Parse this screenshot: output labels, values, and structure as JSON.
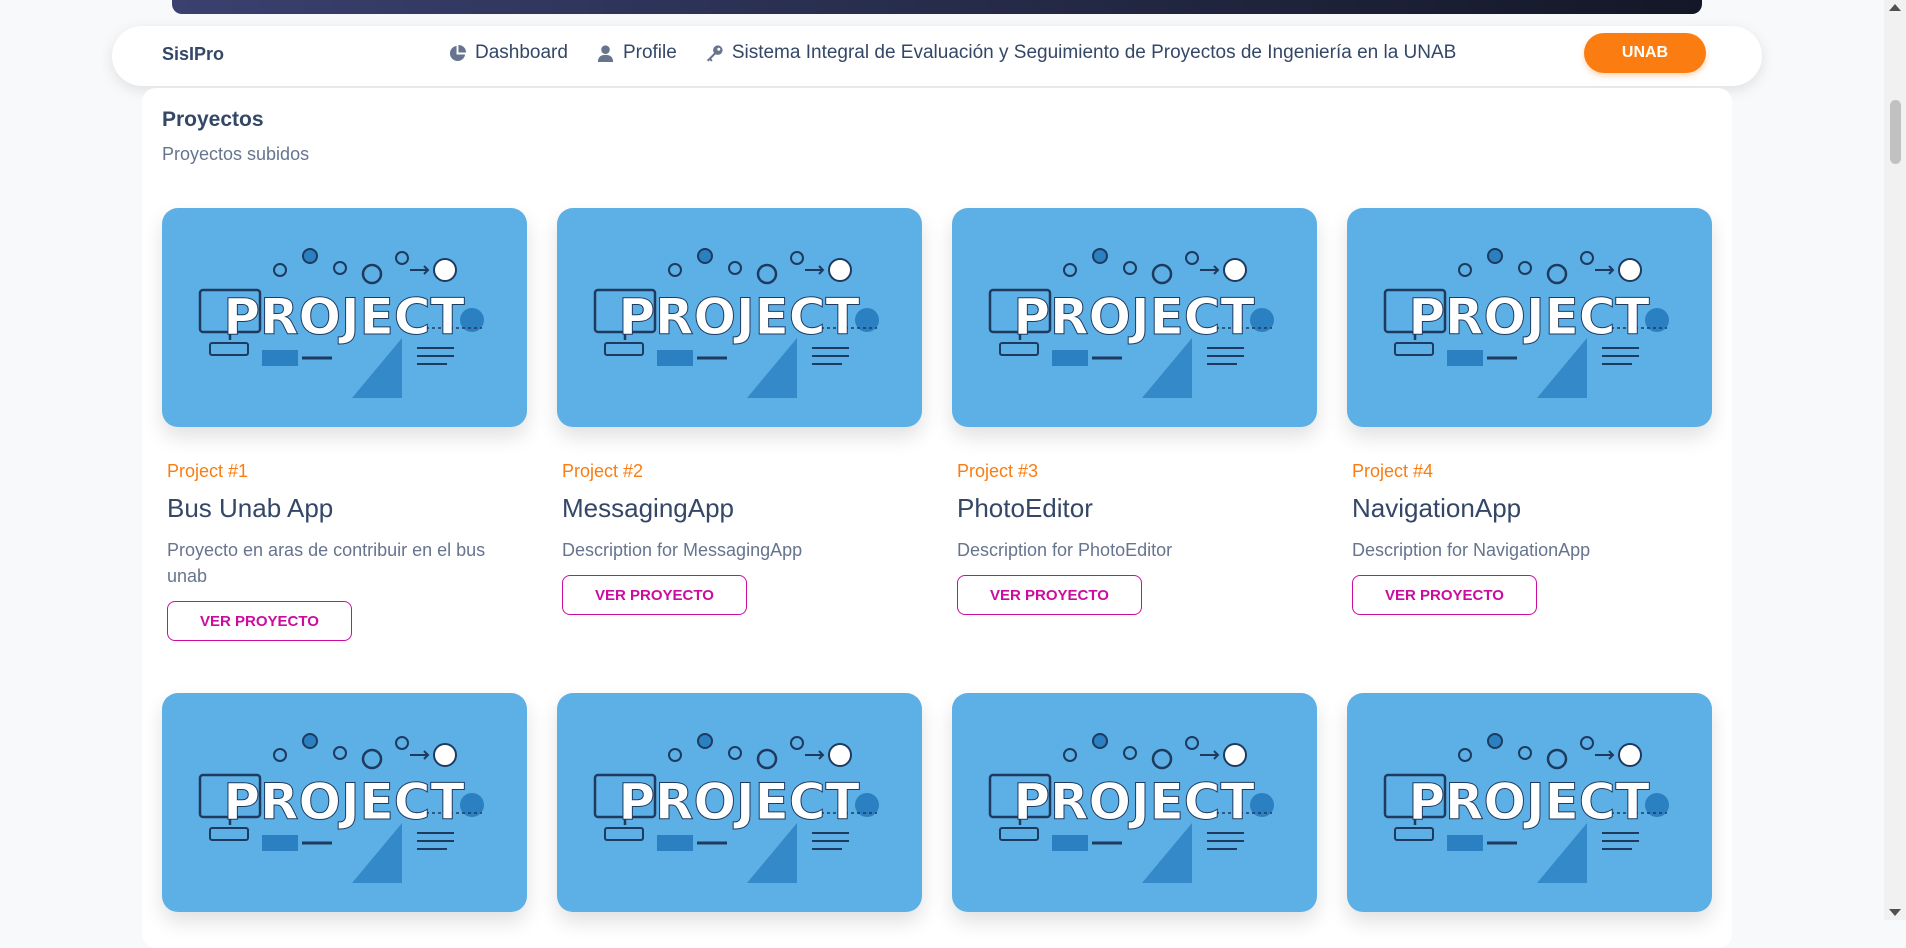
{
  "navbar": {
    "brand": "SisIPro",
    "links": [
      {
        "label": "Dashboard",
        "icon": "pie-chart-icon"
      },
      {
        "label": "Profile",
        "icon": "user-icon"
      },
      {
        "label": "Sistema Integral de Evaluación y Seguimiento de Proyectos de Ingeniería en la UNAB",
        "icon": "key-icon"
      }
    ],
    "button": "UNAB"
  },
  "section": {
    "title": "Proyectos",
    "subtitle": "Proyectos subidos"
  },
  "thumb_text": "PROJECT",
  "projects": [
    {
      "number": "Project #1",
      "name": "Bus Unab App",
      "description": "Proyecto en aras de contribuir en el bus unab",
      "button": "VER PROYECTO"
    },
    {
      "number": "Project #2",
      "name": "MessagingApp",
      "description": "Description for MessagingApp",
      "button": "VER PROYECTO"
    },
    {
      "number": "Project #3",
      "name": "PhotoEditor",
      "description": "Description for PhotoEditor",
      "button": "VER PROYECTO"
    },
    {
      "number": "Project #4",
      "name": "NavigationApp",
      "description": "Description for NavigationApp",
      "button": "VER PROYECTO"
    }
  ],
  "colors": {
    "accent_orange": "#fb7c11",
    "button_pink": "#cb0c9f",
    "thumb_blue": "#5db0e5",
    "text_dark": "#344767",
    "text_muted": "#67748e"
  }
}
